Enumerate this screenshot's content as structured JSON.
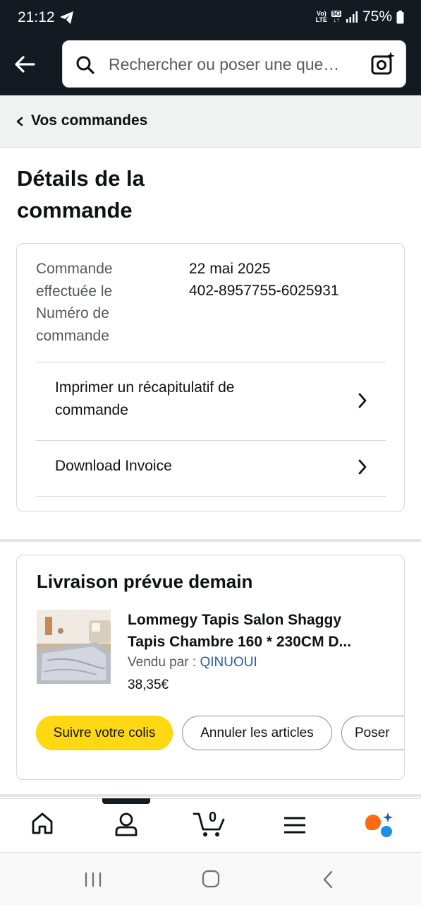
{
  "status_bar": {
    "time": "21:12",
    "network_top": "Vo)",
    "network_bottom": "LTE",
    "fiveg": "5G",
    "battery": "75%"
  },
  "header": {
    "search_placeholder": "Rechercher ou poser une que…",
    "icons": [
      "back-arrow-icon",
      "search-icon",
      "camera-search-icon"
    ]
  },
  "breadcrumb": {
    "label": "Vos commandes"
  },
  "page": {
    "title_line1": "Détails de la",
    "title_line2": "commande"
  },
  "order": {
    "date_label_1": "Commande",
    "date_label_2": "effectuée le",
    "number_label_1": "Numéro de",
    "number_label_2": "commande",
    "date_value": "22 mai 2025",
    "number_value": "402-8957755-6025931",
    "actions": [
      {
        "line1": "Imprimer un récapitulatif de",
        "line2": "commande"
      },
      {
        "label": "Download Invoice"
      }
    ]
  },
  "delivery": {
    "title": "Livraison prévue demain",
    "product_title_line1": "Lommegy Tapis Salon Shaggy",
    "product_title_line2": "Tapis Chambre 160 * 230CM D...",
    "seller_label": "Vendu par",
    "seller_sep": " : ",
    "seller_name": "QINUOUI",
    "price": "38,35€",
    "buttons": [
      "Suivre votre colis",
      "Annuler les articles",
      "Poser"
    ]
  },
  "bottom_nav": {
    "cart_count": "0",
    "items": [
      "home-icon",
      "account-icon",
      "cart-icon",
      "menu-icon",
      "rufus-icon"
    ]
  },
  "colors": {
    "header_bg": "#131a22",
    "accent_yellow": "#ffd814",
    "link_blue": "#2162a1"
  }
}
